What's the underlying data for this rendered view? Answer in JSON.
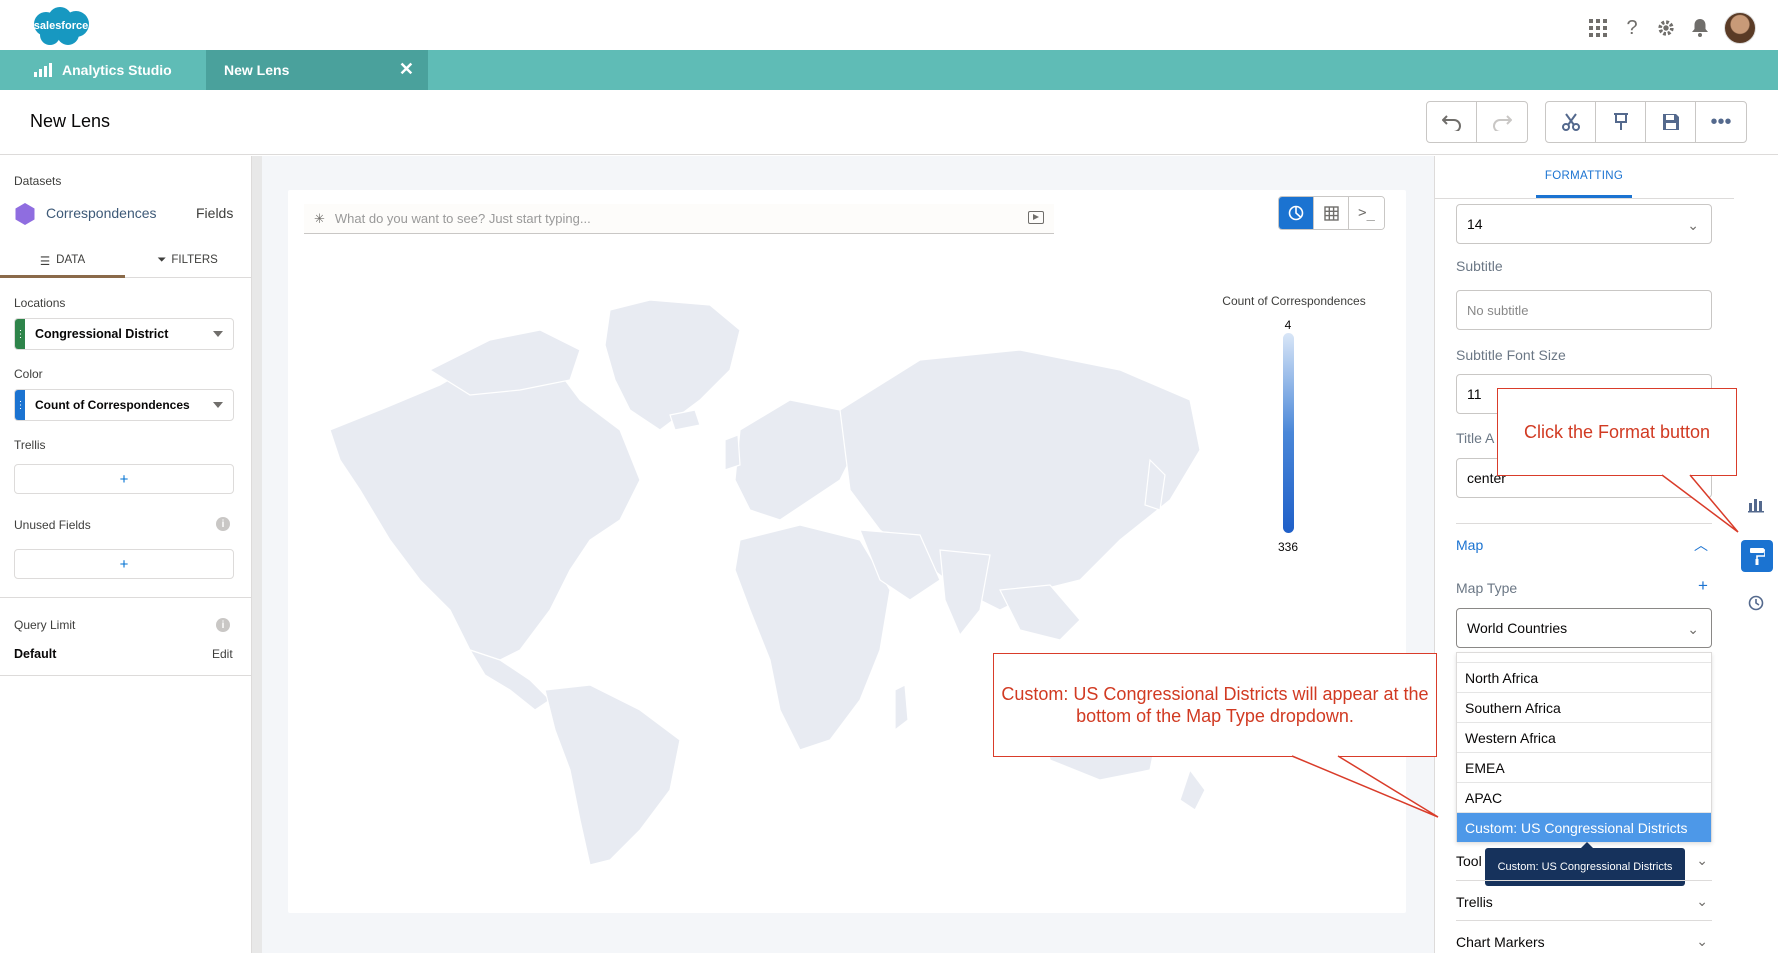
{
  "topbar": {
    "logo_text": "salesforce"
  },
  "tabs": {
    "app_label": "Analytics Studio",
    "lens_label": "New Lens"
  },
  "header": {
    "title": "New Lens"
  },
  "left": {
    "datasets_label": "Datasets",
    "dataset_name": "Correspondences",
    "fields_link": "Fields",
    "data_tab": "DATA",
    "filters_tab": "FILTERS",
    "locations_label": "Locations",
    "locations_value": "Congressional District",
    "color_label": "Color",
    "color_value": "Count of Correspondences",
    "trellis_label": "Trellis",
    "unused_label": "Unused Fields",
    "add": "+",
    "query_limit_label": "Query Limit",
    "query_limit_value": "Default",
    "edit_link": "Edit"
  },
  "canvas": {
    "search_placeholder": "What do you want to see? Just start typing...",
    "legend_title": "Count of Correspondences",
    "legend_min": "4",
    "legend_max": "336"
  },
  "format": {
    "tab_label": "FORMATTING",
    "title_font_size": "14",
    "subtitle_label": "Subtitle",
    "subtitle_placeholder": "No subtitle",
    "subtitle_font_size_label": "Subtitle Font Size",
    "subtitle_font_size": "11",
    "title_align_label": "Title A",
    "title_align_value": "center",
    "map_section": "Map",
    "map_type_label": "Map Type",
    "map_type_value": "World Countries",
    "options": [
      "North Africa",
      "Southern Africa",
      "Western Africa",
      "EMEA",
      "APAC",
      "Custom: US Congressional Districts"
    ],
    "tooltip": "Custom: US Congressional Districts",
    "tooltips_section": "Tool",
    "trellis_section": "Trellis",
    "chart_markers_section": "Chart Markers"
  },
  "callouts": {
    "format_button": "Click the Format button",
    "dropdown_note": "Custom: US Congressional Districts will appear at the bottom of the Map Type dropdown."
  },
  "colors": {
    "teal": "#5fbcb6",
    "teal_dark": "#4aa19c",
    "brand": "#1b73d1",
    "callout": "#d93c2a"
  }
}
